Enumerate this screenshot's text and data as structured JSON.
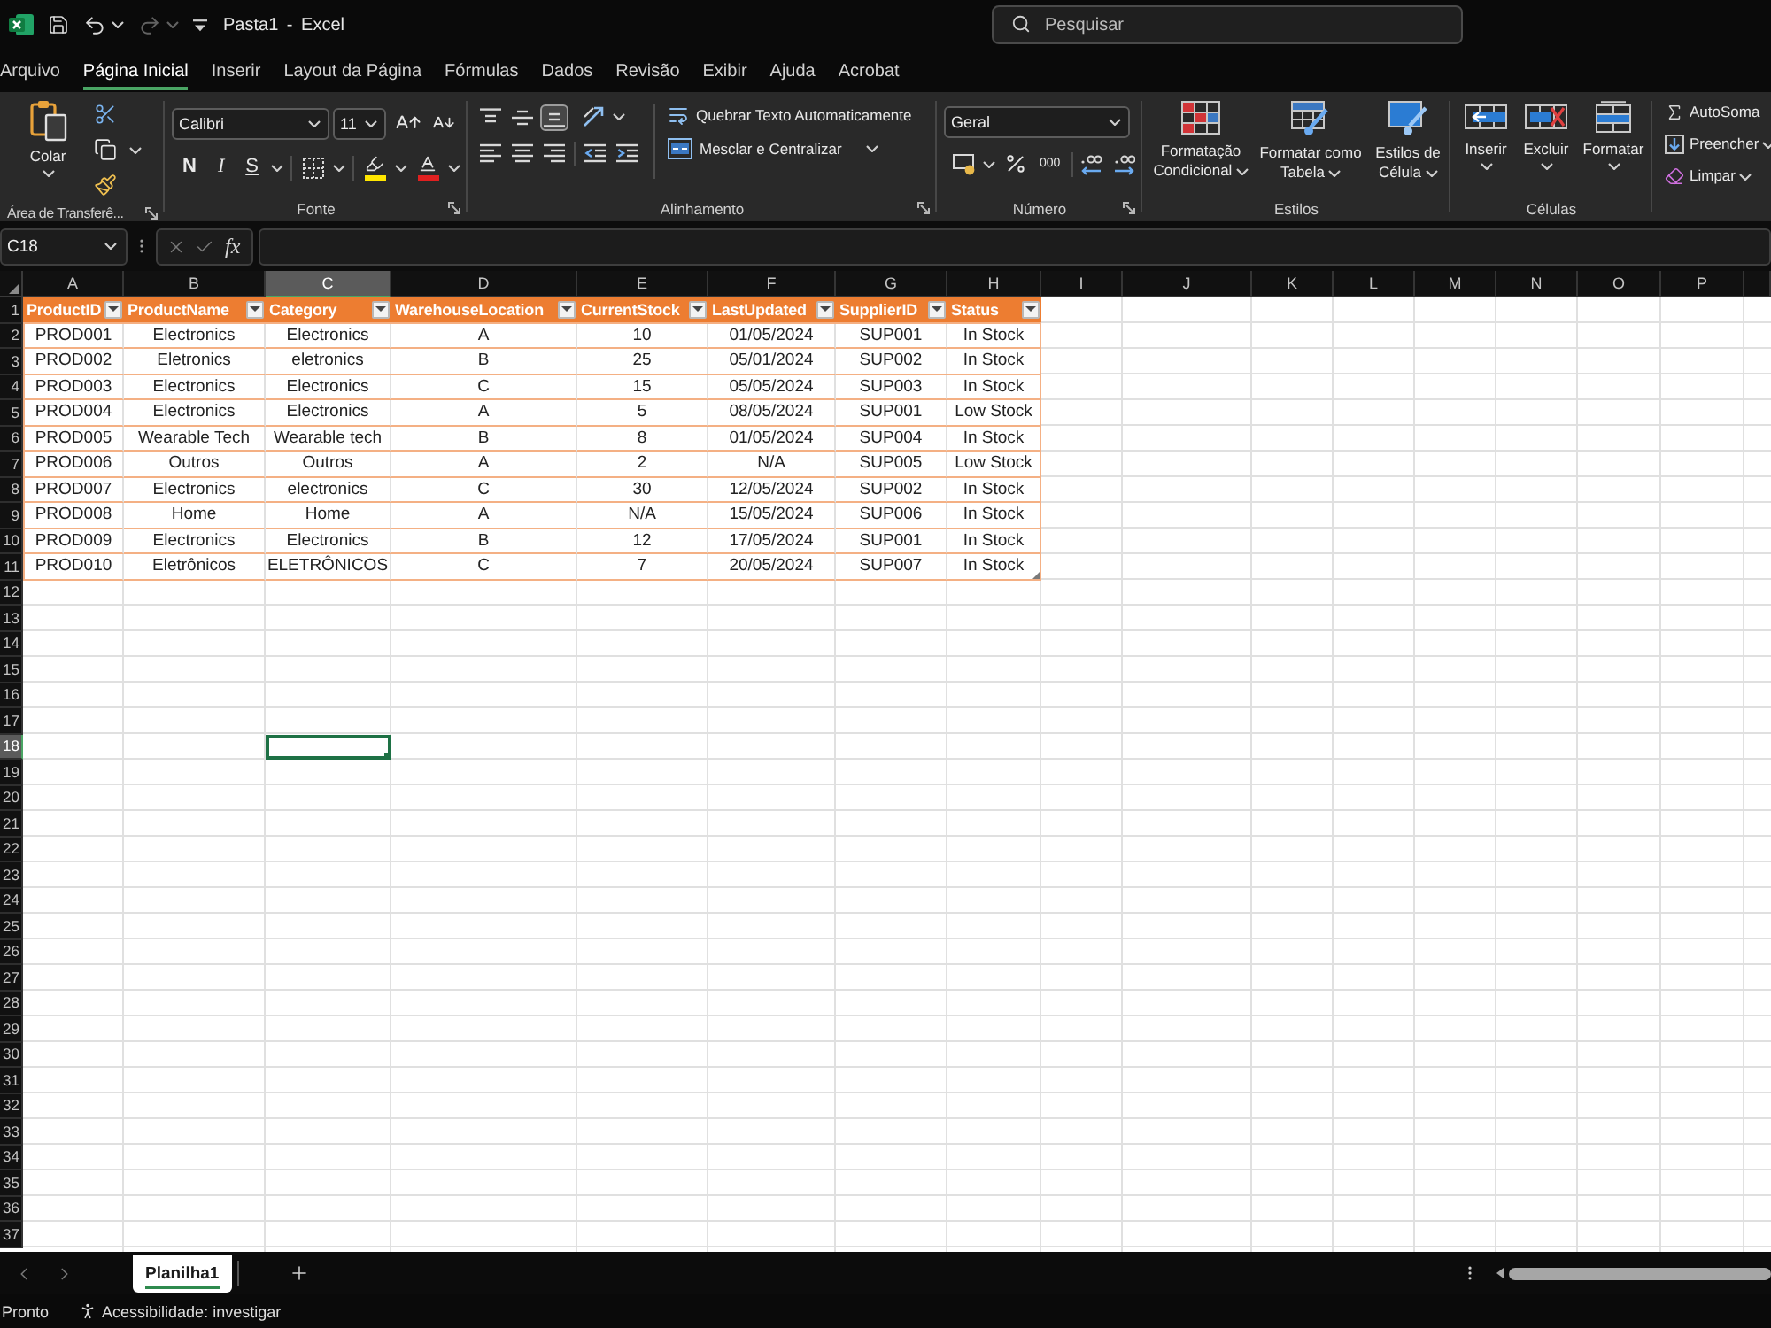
{
  "title_bar": {
    "title": "Pasta1 - Excel",
    "search": {
      "placeholder": "Pesquisar"
    }
  },
  "ribbon_tabs": [
    {
      "label": "Arquivo",
      "selected": false
    },
    {
      "label": "Página Inicial",
      "selected": true
    },
    {
      "label": "Inserir",
      "selected": false
    },
    {
      "label": "Layout da Página",
      "selected": false
    },
    {
      "label": "Fórmulas",
      "selected": false
    },
    {
      "label": "Dados",
      "selected": false
    },
    {
      "label": "Revisão",
      "selected": false
    },
    {
      "label": "Exibir",
      "selected": false
    },
    {
      "label": "Ajuda",
      "selected": false
    },
    {
      "label": "Acrobat",
      "selected": false
    }
  ],
  "ribbon": {
    "clipboard": {
      "label": "Área de Transferê...",
      "paste": "Colar"
    },
    "font": {
      "label": "Fonte",
      "font_name": "Calibri",
      "font_size": "11",
      "bold": "N",
      "italic": "I",
      "underline": "S"
    },
    "alignment": {
      "label": "Alinhamento",
      "vertical_align": [
        {
          "kind": "top",
          "selected": false
        },
        {
          "kind": "middle",
          "selected": false
        },
        {
          "kind": "bottom",
          "selected": true
        }
      ],
      "wrap_text": "Quebrar Texto Automaticamente",
      "merge_center": "Mesclar e Centralizar"
    },
    "number": {
      "label": "Número",
      "format": "Geral",
      "thousands": "000"
    },
    "styles": {
      "label": "Estilos",
      "buttons": [
        {
          "kind": "conditional",
          "label": "Formatação Condicional"
        },
        {
          "kind": "table",
          "label": "Formatar como Tabela"
        },
        {
          "kind": "cell",
          "label": "Estilos de Célula"
        }
      ]
    },
    "cells": {
      "label": "Células",
      "buttons": [
        {
          "kind": "insert",
          "label": "Inserir"
        },
        {
          "kind": "delete",
          "label": "Excluir"
        },
        {
          "kind": "format",
          "label": "Formatar"
        }
      ]
    },
    "editing": {
      "buttons": [
        {
          "kind": "autosum",
          "label": "AutoSoma"
        },
        {
          "kind": "fill",
          "label": "Preencher"
        },
        {
          "kind": "clear",
          "label": "Limpar"
        }
      ]
    }
  },
  "formula_bar": {
    "name_box": "C18",
    "function_label": "fx"
  },
  "sheet": {
    "columns": [
      {
        "label": "A",
        "selected": false
      },
      {
        "label": "B",
        "selected": false
      },
      {
        "label": "C",
        "selected": true
      },
      {
        "label": "D",
        "selected": false
      },
      {
        "label": "E",
        "selected": false
      },
      {
        "label": "F",
        "selected": false
      },
      {
        "label": "G",
        "selected": false
      },
      {
        "label": "H",
        "selected": false
      },
      {
        "label": "I",
        "selected": false
      },
      {
        "label": "J",
        "selected": false
      },
      {
        "label": "K",
        "selected": false
      },
      {
        "label": "L",
        "selected": false
      },
      {
        "label": "M",
        "selected": false
      },
      {
        "label": "N",
        "selected": false
      },
      {
        "label": "O",
        "selected": false
      },
      {
        "label": "P",
        "selected": false
      }
    ],
    "rows": [
      {
        "label": "1",
        "selected": false
      },
      {
        "label": "2",
        "selected": false
      },
      {
        "label": "3",
        "selected": false
      },
      {
        "label": "4",
        "selected": false
      },
      {
        "label": "5",
        "selected": false
      },
      {
        "label": "6",
        "selected": false
      },
      {
        "label": "7",
        "selected": false
      },
      {
        "label": "8",
        "selected": false
      },
      {
        "label": "9",
        "selected": false
      },
      {
        "label": "10",
        "selected": false
      },
      {
        "label": "11",
        "selected": false
      },
      {
        "label": "12",
        "selected": false
      },
      {
        "label": "13",
        "selected": false
      },
      {
        "label": "14",
        "selected": false
      },
      {
        "label": "15",
        "selected": false
      },
      {
        "label": "16",
        "selected": false
      },
      {
        "label": "17",
        "selected": false
      },
      {
        "label": "18",
        "selected": true
      },
      {
        "label": "19",
        "selected": false
      },
      {
        "label": "20",
        "selected": false
      },
      {
        "label": "21",
        "selected": false
      },
      {
        "label": "22",
        "selected": false
      },
      {
        "label": "23",
        "selected": false
      },
      {
        "label": "24",
        "selected": false
      },
      {
        "label": "25",
        "selected": false
      },
      {
        "label": "26",
        "selected": false
      },
      {
        "label": "27",
        "selected": false
      },
      {
        "label": "28",
        "selected": false
      },
      {
        "label": "29",
        "selected": false
      },
      {
        "label": "30",
        "selected": false
      },
      {
        "label": "31",
        "selected": false
      },
      {
        "label": "32",
        "selected": false
      },
      {
        "label": "33",
        "selected": false
      },
      {
        "label": "34",
        "selected": false
      },
      {
        "label": "35",
        "selected": false
      },
      {
        "label": "36",
        "selected": false
      },
      {
        "label": "37",
        "selected": false
      }
    ]
  },
  "table": {
    "columns": [
      "ProductID",
      "ProductName",
      "Category",
      "WarehouseLocation",
      "CurrentStock",
      "LastUpdated",
      "SupplierID",
      "Status"
    ],
    "rows": [
      [
        "PROD001",
        "Electronics",
        "Electronics",
        "A",
        "10",
        "01/05/2024",
        "SUP001",
        "In Stock"
      ],
      [
        "PROD002",
        "Eletronics",
        "eletronics",
        "B",
        "25",
        "05/01/2024",
        "SUP002",
        "In Stock"
      ],
      [
        "PROD003",
        "Electronics",
        "Electronics",
        "C",
        "15",
        "05/05/2024",
        "SUP003",
        "In Stock"
      ],
      [
        "PROD004",
        "Electronics",
        "Electronics",
        "A",
        "5",
        "08/05/2024",
        "SUP001",
        "Low Stock"
      ],
      [
        "PROD005",
        "Wearable Tech",
        "Wearable tech",
        "B",
        "8",
        "01/05/2024",
        "SUP004",
        "In Stock"
      ],
      [
        "PROD006",
        "Outros",
        "Outros",
        "A",
        "2",
        "N/A",
        "SUP005",
        "Low Stock"
      ],
      [
        "PROD007",
        "Electronics",
        "electronics",
        "C",
        "30",
        "12/05/2024",
        "SUP002",
        "In Stock"
      ],
      [
        "PROD008",
        "Home",
        "Home",
        "A",
        "N/A",
        "15/05/2024",
        "SUP006",
        "In Stock"
      ],
      [
        "PROD009",
        "Electronics",
        "Electronics",
        "B",
        "12",
        "17/05/2024",
        "SUP001",
        "In Stock"
      ],
      [
        "PROD010",
        "Eletrônicos",
        "ELETRÔNICOS",
        "C",
        "7",
        "20/05/2024",
        "SUP007",
        "In Stock"
      ]
    ]
  },
  "sheet_tabs": [
    {
      "label": "Planilha1",
      "selected": true
    }
  ],
  "status_bar": {
    "status": "Pronto",
    "accessibility": "Acessibilidade: investigar"
  }
}
